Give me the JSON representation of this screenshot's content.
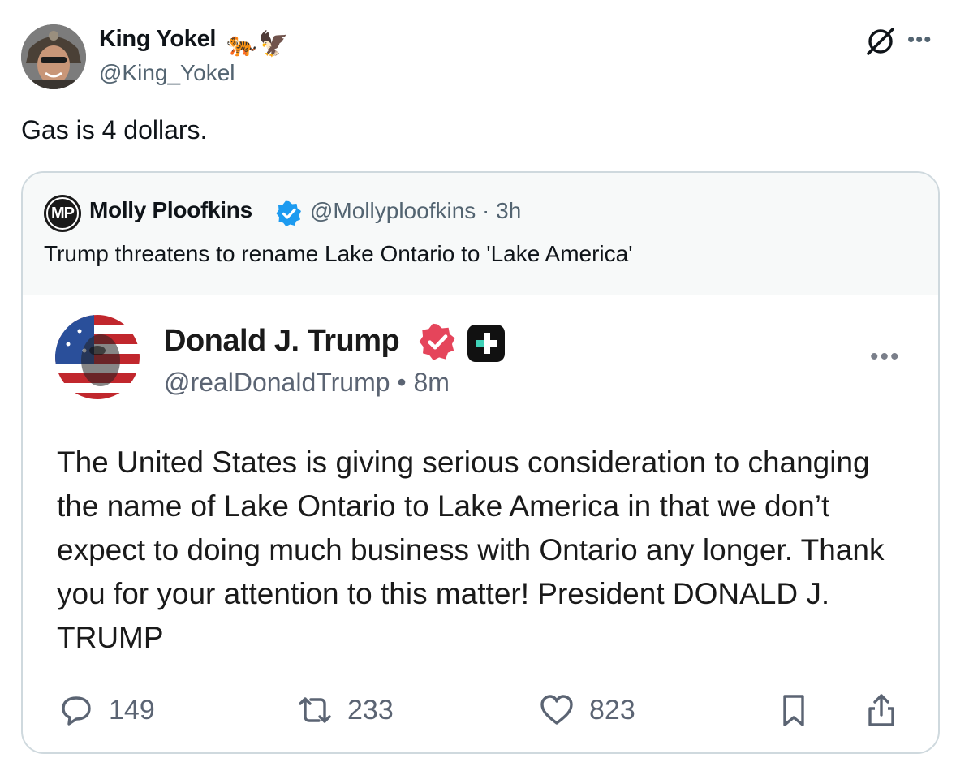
{
  "author": {
    "name": "King Yokel",
    "emoji": [
      "🐅",
      "🦅"
    ],
    "handle": "@King_Yokel"
  },
  "tweet": {
    "text": "Gas is 4 dollars."
  },
  "quote": {
    "avatar_initials": "MP",
    "name": "Molly Ploofkins",
    "handle_time": "@Mollyploofkins · 3h",
    "text": "Trump threatens to rename Lake Ontario to 'Lake America'"
  },
  "embedded_post": {
    "name": "Donald J. Trump",
    "handle_time": "@realDonaldTrump • 8m",
    "body": "The United States is giving serious consideration to changing the name of Lake Ontario to Lake America in that we don’t expect to doing much business with Ontario any longer. Thank you for your attention to this matter! President DONALD J. TRUMP",
    "actions": {
      "replies": "149",
      "reposts": "233",
      "likes": "823"
    }
  },
  "icons": {
    "grok": "grok-icon",
    "more": "more-icon",
    "verified": "verified-badge-icon",
    "reply": "reply-icon",
    "repost": "repost-icon",
    "like": "heart-icon",
    "bookmark": "bookmark-icon",
    "share": "share-icon"
  },
  "colors": {
    "verified_blue": "#1d9bf0",
    "truth_verified": "#e5455b",
    "muted_text": "#536471"
  }
}
